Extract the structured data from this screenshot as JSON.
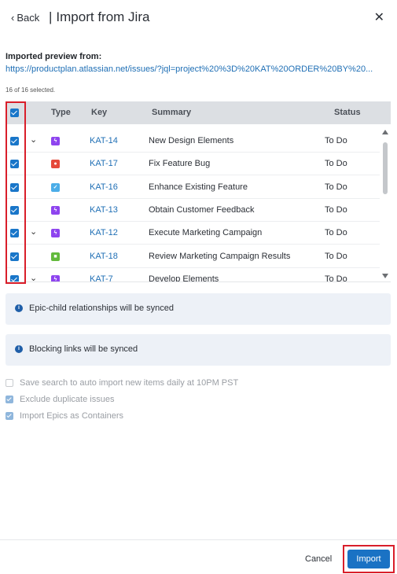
{
  "header": {
    "back_label": "Back",
    "back_chevron": "‹",
    "separator": "|",
    "title": "Import from Jira",
    "close_glyph": "✕"
  },
  "preview": {
    "label": "Imported preview from:",
    "url": "https://productplan.atlassian.net/issues/?jql=project%20%3D%20KAT%20ORDER%20BY%20...",
    "selected_text": "16 of 16 selected."
  },
  "table": {
    "headers": {
      "type": "Type",
      "key": "Key",
      "summary": "Summary",
      "status": "Status"
    },
    "rows": [
      {
        "expand": "⌄",
        "icon": "epic-icon",
        "icon_color": "#8e44ef",
        "key": "KAT-14",
        "summary": "New Design Elements",
        "status": "To Do",
        "checked": true
      },
      {
        "expand": "",
        "icon": "bug-icon",
        "icon_color": "#e5493a",
        "key": "KAT-17",
        "summary": "Fix Feature Bug",
        "status": "To Do",
        "checked": true
      },
      {
        "expand": "",
        "icon": "task-icon",
        "icon_color": "#4bade8",
        "key": "KAT-16",
        "summary": "Enhance Existing Feature",
        "status": "To Do",
        "checked": true
      },
      {
        "expand": "",
        "icon": "epic-icon",
        "icon_color": "#8e44ef",
        "key": "KAT-13",
        "summary": "Obtain Customer Feedback",
        "status": "To Do",
        "checked": true
      },
      {
        "expand": "⌄",
        "icon": "epic-icon",
        "icon_color": "#8e44ef",
        "key": "KAT-12",
        "summary": "Execute Marketing Campaign",
        "status": "To Do",
        "checked": true
      },
      {
        "expand": "",
        "icon": "story-icon",
        "icon_color": "#63ba3c",
        "key": "KAT-18",
        "summary": "Review Marketing Campaign Results",
        "status": "To Do",
        "checked": true
      },
      {
        "expand": "⌄",
        "icon": "epic-icon",
        "icon_color": "#8e44ef",
        "key": "KAT-7",
        "summary": "Develop Elements",
        "status": "To Do",
        "checked": true
      }
    ]
  },
  "info": {
    "epic_child": "Epic-child relationships will be synced",
    "blocking": "Blocking links will be synced",
    "icon_glyph": "i"
  },
  "options": [
    {
      "label": "Save search to auto import new items daily at 10PM PST",
      "checked": false
    },
    {
      "label": "Exclude duplicate issues",
      "checked": true
    },
    {
      "label": "Import Epics as Containers",
      "checked": true
    }
  ],
  "footer": {
    "cancel_label": "Cancel",
    "import_label": "Import"
  },
  "colors": {
    "accent": "#1a72c4",
    "link": "#1f6fb5",
    "highlight": "#d91e2a"
  }
}
